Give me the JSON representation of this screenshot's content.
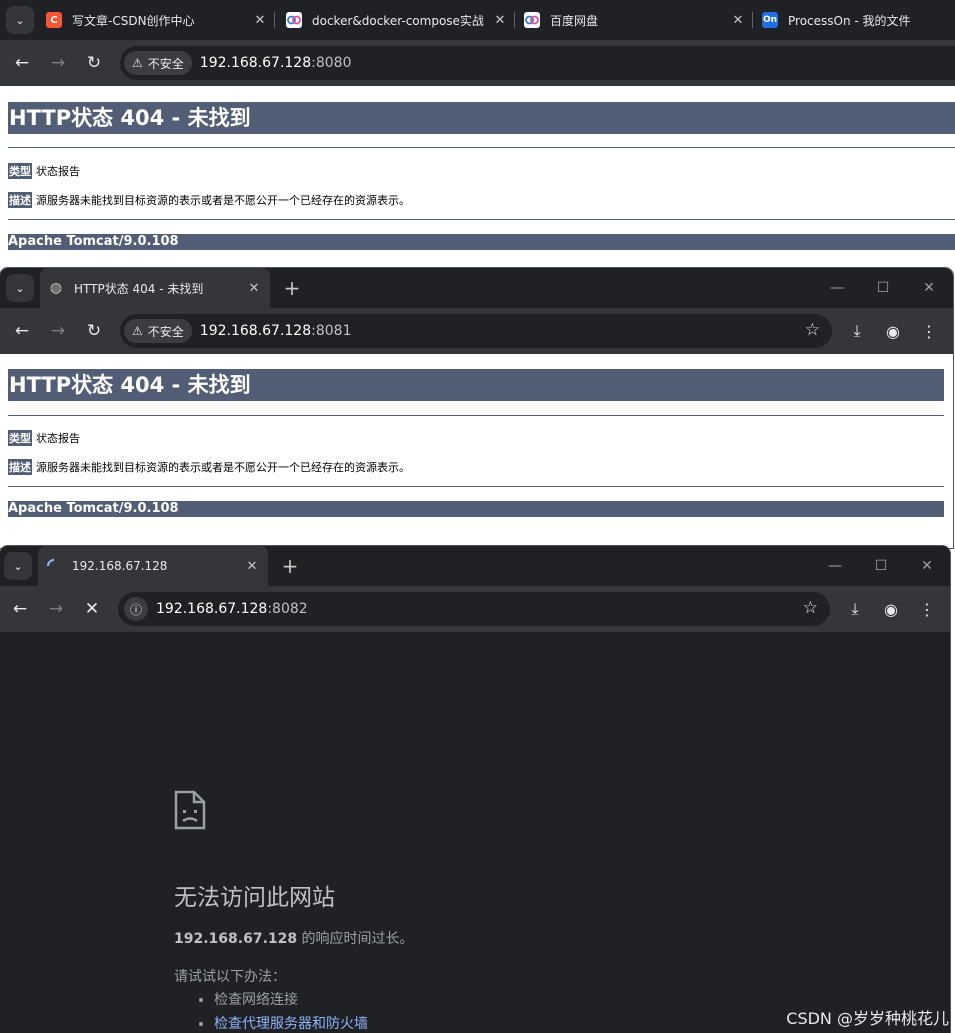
{
  "window1": {
    "tabs": [
      {
        "title": "写文章-CSDN创作中心",
        "favicon": "C",
        "favicon_color": "#fc5531",
        "icon": "csdn-icon"
      },
      {
        "title": "docker&docker-compose实战",
        "favicon": "",
        "favicon_color": "#4a90e2",
        "icon": "baidu-pan-icon"
      },
      {
        "title": "百度网盘",
        "favicon": "",
        "favicon_color": "#4a90e2",
        "icon": "baidu-pan-icon"
      },
      {
        "title": "ProcessOn - 我的文件",
        "favicon": "On",
        "favicon_color": "#1e6fe6",
        "icon": "processon-icon"
      }
    ],
    "security_chip": "不安全",
    "url_host": "192.168.67.128",
    "url_port": ":8080",
    "page": {
      "heading": "HTTP状态 404 - 未找到",
      "type_label": "类型",
      "type_value": "状态报告",
      "desc_label": "描述",
      "desc_value": "源服务器未能找到目标资源的表示或者是不愿公开一个已经存在的资源表示。",
      "footer": "Apache Tomcat/9.0.108"
    }
  },
  "window2": {
    "tab_title": "HTTP状态 404 - 未找到",
    "security_chip": "不安全",
    "url_host": "192.168.67.128",
    "url_port": ":8081",
    "page": {
      "heading": "HTTP状态 404 - 未找到",
      "type_label": "类型",
      "type_value": "状态报告",
      "desc_label": "描述",
      "desc_value": "源服务器未能找到目标资源的表示或者是不愿公开一个已经存在的资源表示。",
      "footer": "Apache Tomcat/9.0.108"
    }
  },
  "window3": {
    "tab_title": "192.168.67.128",
    "url_host": "192.168.67.128",
    "url_port": ":8082",
    "error": {
      "heading": "无法访问此网站",
      "desc_host": "192.168.67.128",
      "desc_rest": " 的响应时间过长。",
      "try_label": "请试试以下办法：",
      "suggestions": [
        "检查网络连接",
        "检查代理服务器和防火墙"
      ]
    }
  },
  "watermark": "CSDN @岁岁种桃花儿"
}
